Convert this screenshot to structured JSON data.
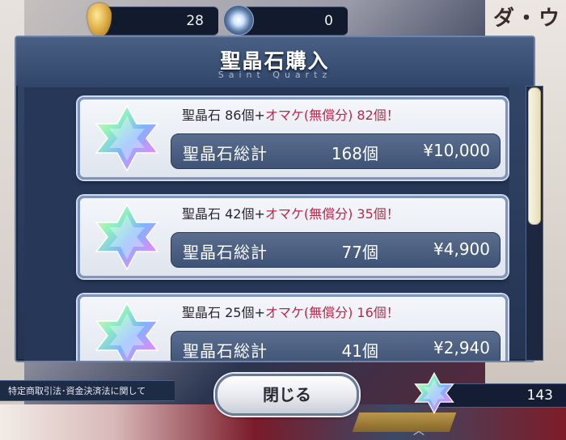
{
  "currency": {
    "gold_icon": "golden-apple-icon",
    "gold_value": "28",
    "mana_icon": "mana-prism-icon",
    "mana_value": "0"
  },
  "background_text": "ダ・ウ",
  "dialog": {
    "title": "聖晶石購入",
    "subtitle": "Saint Quartz"
  },
  "products": [
    {
      "icon": "saint-quartz-icon",
      "base": "聖晶石 86個+",
      "bonus": "オマケ(無償分) 82個！",
      "total_label": "聖晶石総計",
      "total_count": "168個",
      "price": "¥10,000"
    },
    {
      "icon": "saint-quartz-icon",
      "base": "聖晶石 42個+",
      "bonus": "オマケ(無償分) 35個！",
      "total_label": "聖晶石総計",
      "total_count": "77個",
      "price": "¥4,900"
    },
    {
      "icon": "saint-quartz-icon",
      "base": "聖晶石 25個+",
      "bonus": "オマケ(無償分) 16個！",
      "total_label": "聖晶石総計",
      "total_count": "41個",
      "price": "¥2,940"
    }
  ],
  "footer": {
    "legal_link": "特定商取引法･資金決済法に関して",
    "close_button": "閉じる",
    "owned_icon": "saint-quartz-icon",
    "owned_count": "143"
  },
  "colors": {
    "bonus_text": "#b8284a",
    "dialog_bg": "#2a3c5b",
    "scroll_thumb": "#f0e9cc"
  }
}
